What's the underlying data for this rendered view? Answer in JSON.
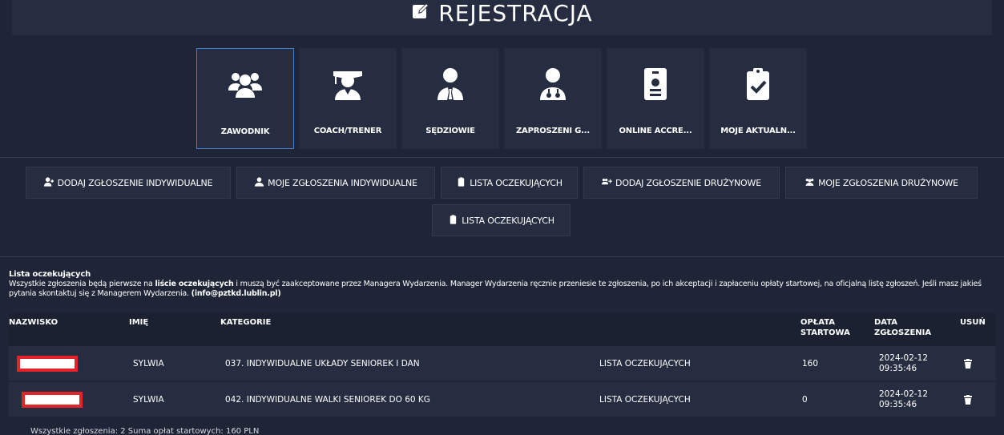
{
  "header": {
    "title": "REJESTRACJA",
    "title_icon": "edit-square-icon"
  },
  "tiles": [
    {
      "label": "ZAWODNIK",
      "icon": "users-icon",
      "active": true
    },
    {
      "label": "COACH/TRENER",
      "icon": "graduate-icon",
      "active": false
    },
    {
      "label": "SĘDZIOWIE",
      "icon": "judge-icon",
      "active": false
    },
    {
      "label": "ZAPROSZENI G...",
      "icon": "doctor-icon",
      "active": false
    },
    {
      "label": "ONLINE ACCRE...",
      "icon": "id-badge-icon",
      "active": false
    },
    {
      "label": "MOJE AKTUALN...",
      "icon": "clipboard-check-icon",
      "active": false
    }
  ],
  "actions": {
    "add_individual": "DODAJ ZGŁOSZENIE INDYWIDUALNE",
    "my_individual": "MOJE ZGŁOSZENIA INDYWIDUALNE",
    "waiting_list_1": "LISTA OCZEKUJĄCYCH",
    "add_team": "DODAJ ZGŁOSZENIE DRUŻYNOWE",
    "my_team": "MOJE ZGŁOSZENIA DRUŻYNOWE",
    "waiting_list_2": "LISTA OCZEKUJĄCYCH"
  },
  "info": {
    "heading": "Lista oczekujących",
    "text_1": "Wszystkie zgłoszenia będą pierwsze na ",
    "text_bold": "liście oczekujących",
    "text_2": " i muszą być zaakceptowane przez Managera Wydarzenia. Manager Wydarzenia ręcznie przeniesie te zgłoszenia, po ich akceptacji i zapłaceniu opłaty startowej, na oficjalną listę zgłoszeń. Jeśli masz jakieś pytania skontaktuj się z Managerem Wydarzenia.  ",
    "email": "(info@pztkd.lublin.pl)"
  },
  "table": {
    "columns": {
      "surname": "NAZWISKO",
      "name": "IMIĘ",
      "category": "KATEGORIE",
      "fee_1": "OPŁATA",
      "fee_2": "STARTOWA",
      "date_1": "DATA",
      "date_2": "ZGŁOSZENIA",
      "delete": "USUŃ"
    },
    "rows": [
      {
        "name": "SYLWIA",
        "category": "037. INDYWIDUALNE UKŁADY SENIOREK I DAN",
        "status": "LISTA OCZEKUJĄCYCH",
        "fee": "160",
        "date": "2024-02-12",
        "time": "09:35:46"
      },
      {
        "name": "SYLWIA",
        "category": "042. INDYWIDUALNE WALKI SENIOREK DO 60 KG",
        "status": "LISTA OCZEKUJĄCYCH",
        "fee": "0",
        "date": "2024-02-12",
        "time": "09:35:46"
      }
    ]
  },
  "footer": {
    "text": "Wszystkie zgłoszenia: 2    Suma opłat startowych: 160 PLN"
  },
  "colors": {
    "background": "#1f2536",
    "panel": "#272d40",
    "active_border": "#3f7fd6",
    "redaction": "#e3252b"
  }
}
